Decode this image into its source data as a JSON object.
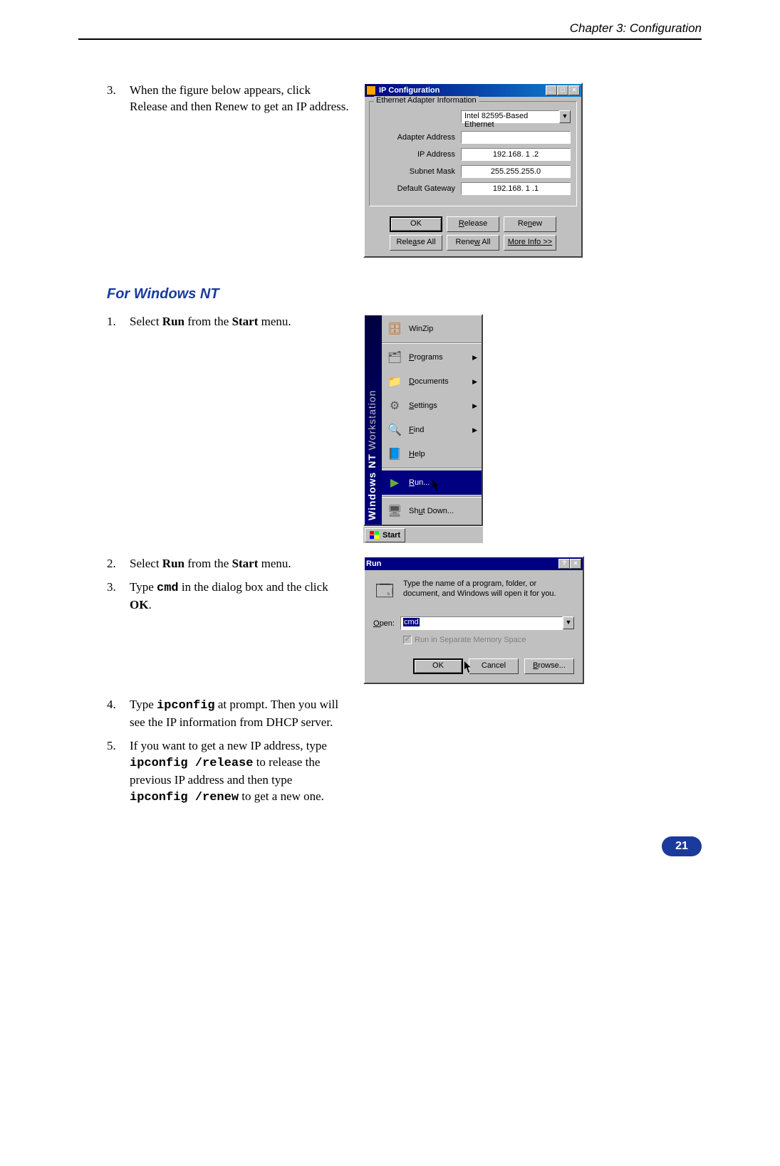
{
  "header": {
    "chapter": "Chapter 3: Configuration"
  },
  "step3_top": {
    "num": "3.",
    "text": "When the figure below appears, click Release and then Renew to get an IP address."
  },
  "ipcfg": {
    "title": "IP Configuration",
    "group": "Ethernet Adapter Information",
    "adapter": "Intel 82595-Based Ethernet",
    "rows": {
      "adapter_addr_label": "Adapter Address",
      "adapter_addr": "",
      "ip_label": "IP Address",
      "ip": "192.168.  1  .2",
      "mask_label": "Subnet Mask",
      "mask": "255.255.255.0",
      "gw_label": "Default Gateway",
      "gw": "192.168.  1  .1"
    },
    "buttons": {
      "ok": "OK",
      "release": "Release",
      "renew": "Renew",
      "release_all": "Release All",
      "renew_all": "Renew All",
      "more": "More Info >>"
    }
  },
  "section_heading": "For Windows NT",
  "nt_step1": {
    "num": "1.",
    "pre": "Select ",
    "b1": "Run",
    "mid": " from the ",
    "b2": "Start",
    "post": " menu."
  },
  "startmenu": {
    "banner1": "Windows NT",
    "banner2": "Workstation",
    "items": {
      "winzip": "WinZip",
      "programs": "Programs",
      "documents": "Documents",
      "settings": "Settings",
      "find": "Find",
      "help": "Help",
      "run": "Run...",
      "shutdown": "Shut Down..."
    },
    "start_btn": "Start"
  },
  "nt_step2": {
    "num": "2.",
    "pre": "Select ",
    "b1": "Run",
    "mid": " from the ",
    "b2": "Start",
    "post": " menu."
  },
  "nt_step3": {
    "num": "3.",
    "pre": "Type ",
    "code": "cmd",
    "mid": " in the dialog box and the click ",
    "b1": "OK",
    "post": "."
  },
  "run": {
    "title": "Run",
    "desc": "Type the name of a program, folder, or document, and Windows will open it for you.",
    "open_label": "Open:",
    "value": "cmd",
    "checkbox": "Run in Separate Memory Space",
    "ok": "OK",
    "cancel": "Cancel",
    "browse": "Browse..."
  },
  "nt_step4": {
    "num": "4.",
    "pre": "Type ",
    "code": "ipconfig",
    "post": " at prompt. Then you will see the IP information from DHCP server."
  },
  "nt_step5": {
    "num": "5.",
    "t1": "If you want to get a new IP address, type ",
    "c1": "ipconfig /release",
    "t2": " to release the previous IP address and then type ",
    "c2": "ipconfig /renew",
    "t3": "  to get a new one."
  },
  "page_number": "21"
}
